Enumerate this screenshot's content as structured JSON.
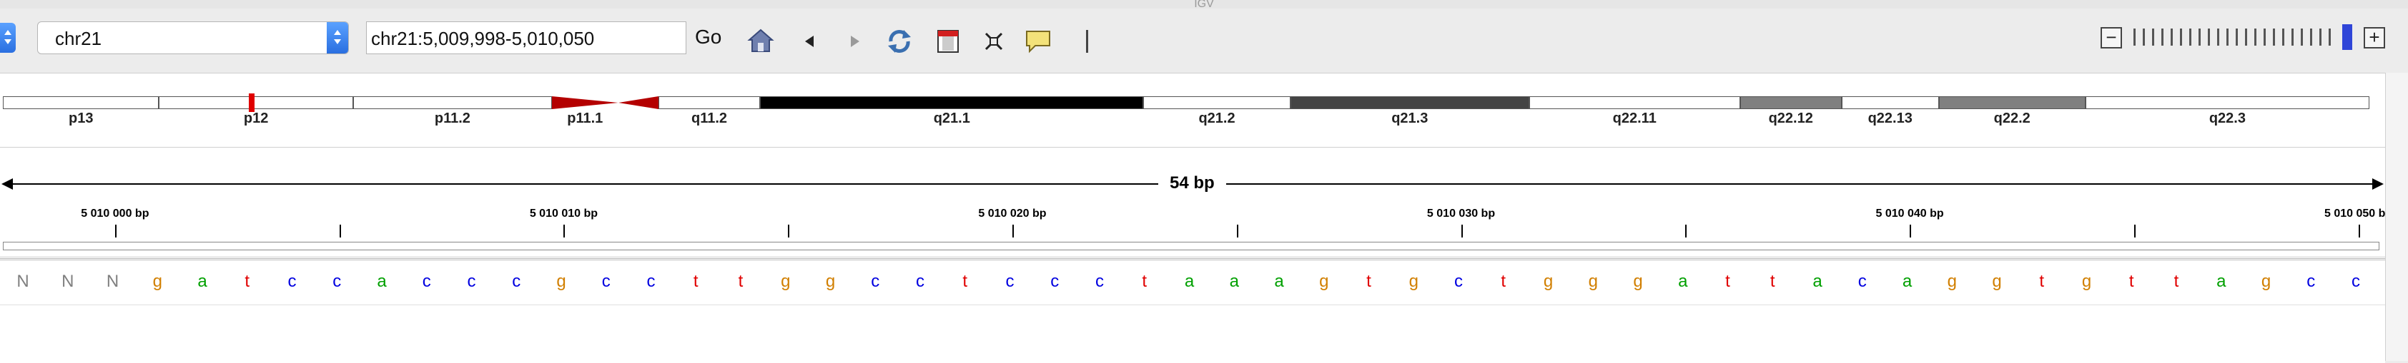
{
  "window": {
    "title": "IGV"
  },
  "toolbar": {
    "chromosome": "chr21",
    "locus": "chr21:5,009,998-5,010,050",
    "go_label": "Go",
    "icons": [
      "home-icon",
      "back-arrow-icon",
      "forward-arrow-icon",
      "refresh-icon",
      "region-of-interest-icon",
      "resize-to-window-icon",
      "popup-text-icon",
      "divider-icon"
    ],
    "zoom_minus": "−",
    "zoom_plus": "+",
    "zoom_level": 0.97
  },
  "ideogram": {
    "bands": [
      {
        "name": "p13",
        "start": 0,
        "end": 0.066,
        "stain": "gneg"
      },
      {
        "name": "p12",
        "start": 0.066,
        "end": 0.148,
        "stain": "gneg",
        "marker": 0.105
      },
      {
        "name": "p11.2",
        "start": 0.148,
        "end": 0.232,
        "stain": "gneg"
      },
      {
        "name": "p11.1",
        "start": 0.232,
        "end": 0.26,
        "stain": "acen-p"
      },
      {
        "name": "",
        "start": 0.26,
        "end": 0.277,
        "stain": "acen-q"
      },
      {
        "name": "q11.2",
        "start": 0.277,
        "end": 0.32,
        "stain": "gneg"
      },
      {
        "name": "q21.1",
        "start": 0.32,
        "end": 0.482,
        "stain": "gpos100"
      },
      {
        "name": "q21.2",
        "start": 0.482,
        "end": 0.544,
        "stain": "gneg"
      },
      {
        "name": "q21.3",
        "start": 0.544,
        "end": 0.645,
        "stain": "gpos75"
      },
      {
        "name": "q22.11",
        "start": 0.645,
        "end": 0.734,
        "stain": "gneg"
      },
      {
        "name": "q22.12",
        "start": 0.734,
        "end": 0.777,
        "stain": "gpos50"
      },
      {
        "name": "q22.13",
        "start": 0.777,
        "end": 0.818,
        "stain": "gneg"
      },
      {
        "name": "q22.2",
        "start": 0.818,
        "end": 0.88,
        "stain": "gpos50"
      },
      {
        "name": "q22.3",
        "start": 0.88,
        "end": 1,
        "stain": "gneg"
      }
    ]
  },
  "ruler": {
    "span_label": "54 bp",
    "start_bp": 5009997.5,
    "end_bp": 5010050.5,
    "tick_labels": [
      {
        "bp": 5010000,
        "label": "5 010 000 bp"
      },
      {
        "bp": 5010010,
        "label": "5 010 010 bp"
      },
      {
        "bp": 5010020,
        "label": "5 010 020 bp"
      },
      {
        "bp": 5010030,
        "label": "5 010 030 bp"
      },
      {
        "bp": 5010040,
        "label": "5 010 040 bp"
      },
      {
        "bp": 5010050,
        "label": "5 010 050 bp"
      }
    ],
    "minor_ticks_bp": [
      5010005,
      5010015,
      5010025,
      5010035,
      5010045
    ]
  },
  "sequence": {
    "bases": "NNNgatccacccgccttggcctccctaaagtgctgggattacaggtgttagcca",
    "colors": {
      "a": "#00a000",
      "c": "#0000e0",
      "g": "#d17f00",
      "t": "#e00000",
      "N": "#808080"
    }
  }
}
